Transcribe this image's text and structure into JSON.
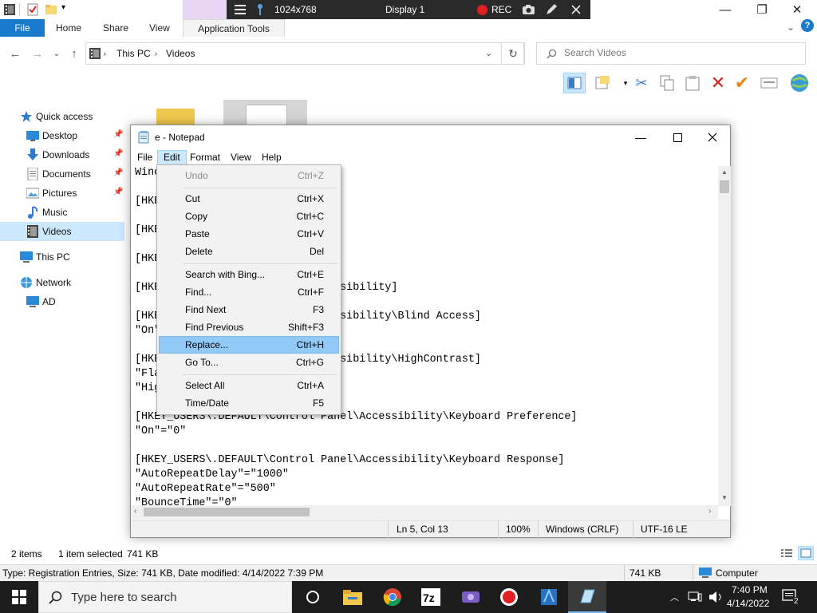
{
  "explorer": {
    "ribbon_tabs": [
      "File",
      "Home",
      "Share",
      "View",
      "Application Tools"
    ],
    "address": {
      "crumbs": [
        "This PC",
        "Videos"
      ]
    },
    "search": {
      "placeholder": "Search Videos"
    },
    "nav": [
      {
        "label": "Quick access",
        "icon": "star-icon"
      },
      {
        "label": "Desktop",
        "icon": "desktop-icon",
        "pinned": true
      },
      {
        "label": "Downloads",
        "icon": "download-icon",
        "pinned": true
      },
      {
        "label": "Documents",
        "icon": "document-icon",
        "pinned": true
      },
      {
        "label": "Pictures",
        "icon": "picture-icon",
        "pinned": true
      },
      {
        "label": "Music",
        "icon": "music-icon"
      },
      {
        "label": "Videos",
        "icon": "video-icon",
        "selected": true
      },
      {
        "label": "This PC",
        "icon": "computer-icon"
      },
      {
        "label": "Network",
        "icon": "network-icon"
      },
      {
        "label": "AD",
        "icon": "monitor-icon"
      }
    ],
    "status": {
      "items": "2 items",
      "selected": "1 item selected",
      "size": "741 KB"
    },
    "info": {
      "text": "Type: Registration Entries, Size: 741 KB, Date modified: 4/14/2022 7:39 PM",
      "size": "741 KB",
      "location": "Computer"
    }
  },
  "remote_bar": {
    "resolution": "1024x768",
    "display": "Display 1",
    "rec": "REC"
  },
  "notepad": {
    "title": "e - Notepad",
    "menus": [
      "File",
      "Edit",
      "Format",
      "View",
      "Help"
    ],
    "lines": [
      "Winc                    5.00",
      "",
      "[HKE",
      "",
      "[HKE",
      "",
      "[HKE                    el]",
      "",
      "[HKE                    el\\Accessibility]",
      "",
      "[HKE                    el\\Accessibility\\Blind Access]",
      "\"On\"",
      "",
      "[HKE                    el\\Accessibility\\HighContrast]",
      "\"Fla",
      "\"Hig",
      "",
      "[HKEY_USERS\\.DEFAULT\\Control Panel\\Accessibility\\Keyboard Preference]",
      "\"On\"=\"0\"",
      "",
      "[HKEY_USERS\\.DEFAULT\\Control Panel\\Accessibility\\Keyboard Response]",
      "\"AutoRepeatDelay\"=\"1000\"",
      "\"AutoRepeatRate\"=\"500\"",
      "\"BounceTime\"=\"0\""
    ],
    "status": {
      "position": "Ln 5, Col 13",
      "zoom": "100%",
      "eol": "Windows (CRLF)",
      "encoding": "UTF-16 LE"
    }
  },
  "edit_menu": [
    {
      "label": "Undo",
      "key": "Ctrl+Z",
      "disabled": true
    },
    {
      "separator": true
    },
    {
      "label": "Cut",
      "key": "Ctrl+X"
    },
    {
      "label": "Copy",
      "key": "Ctrl+C"
    },
    {
      "label": "Paste",
      "key": "Ctrl+V"
    },
    {
      "label": "Delete",
      "key": "Del"
    },
    {
      "separator": true
    },
    {
      "label": "Search with Bing...",
      "key": "Ctrl+E"
    },
    {
      "label": "Find...",
      "key": "Ctrl+F"
    },
    {
      "label": "Find Next",
      "key": "F3"
    },
    {
      "label": "Find Previous",
      "key": "Shift+F3"
    },
    {
      "label": "Replace...",
      "key": "Ctrl+H",
      "hover": true
    },
    {
      "label": "Go To...",
      "key": "Ctrl+G"
    },
    {
      "separator": true
    },
    {
      "label": "Select All",
      "key": "Ctrl+A"
    },
    {
      "label": "Time/Date",
      "key": "F5"
    }
  ],
  "taskbar": {
    "search_placeholder": "Type here to search",
    "time": "7:40 PM",
    "date": "4/14/2022",
    "notification_count": "2"
  },
  "colors": {
    "accent": "#1979ca",
    "selection": "#cce8ff",
    "menu_hover": "#91c9f7",
    "taskbar": "#1d1d1d"
  }
}
